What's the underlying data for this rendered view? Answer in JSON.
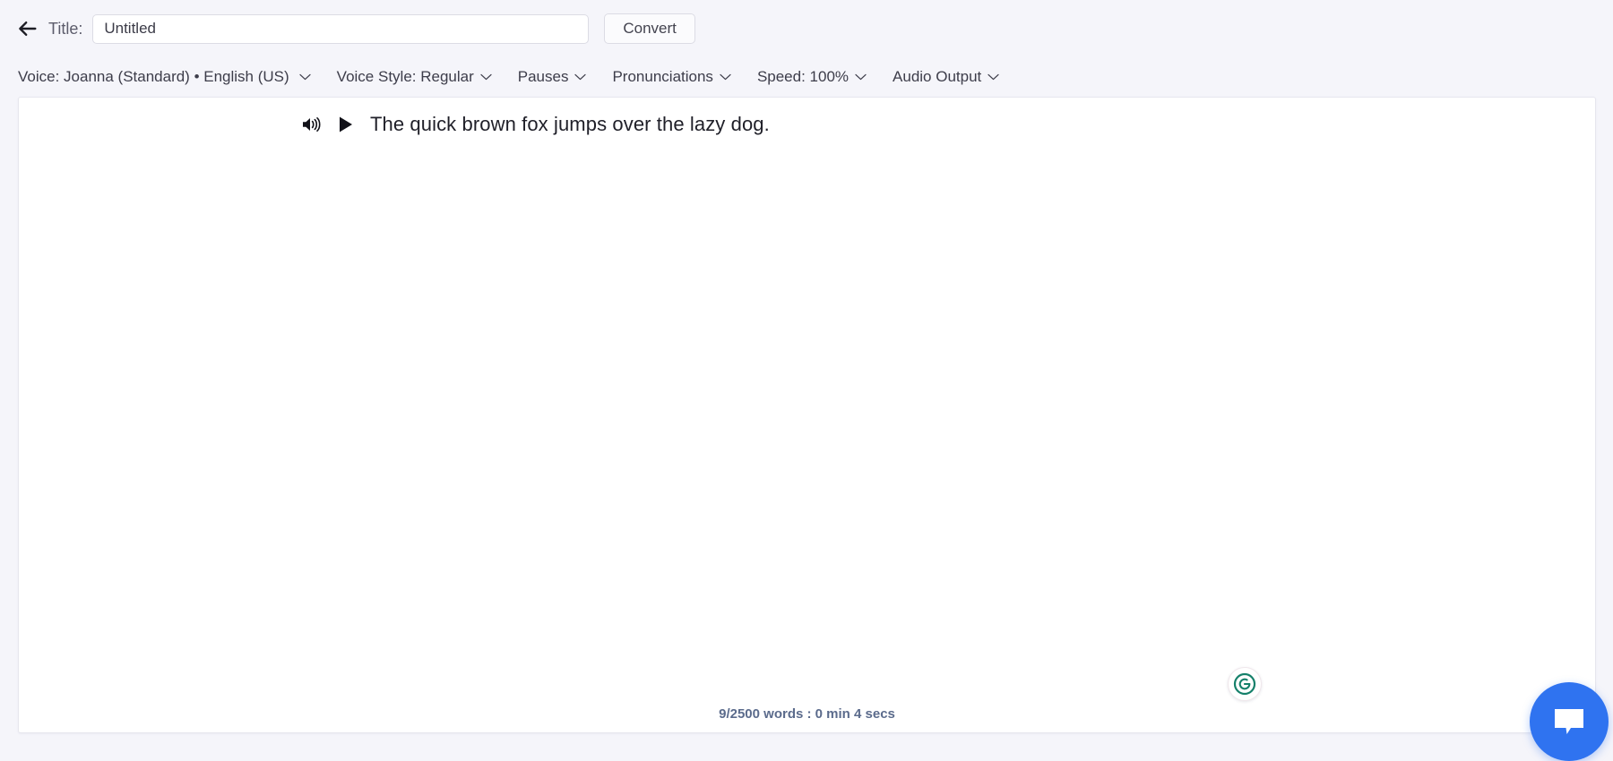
{
  "topbar": {
    "back_icon": "arrow-left-icon",
    "title_label": "Title:",
    "title_value": "Untitled",
    "title_placeholder": "Untitled",
    "convert_label": "Convert"
  },
  "options": [
    {
      "label": "Voice: Joanna (Standard) • English (US)",
      "name": "voice-selector",
      "icon": "chevron-down-icon"
    },
    {
      "label": "Voice Style: Regular",
      "name": "voice-style-selector",
      "icon": "chevron-down-icon"
    },
    {
      "label": "Pauses",
      "name": "pauses-selector",
      "icon": "chevron-down-icon"
    },
    {
      "label": "Pronunciations",
      "name": "pronunciations-selector",
      "icon": "chevron-down-icon"
    },
    {
      "label": "Speed: 100%",
      "name": "speed-selector",
      "icon": "chevron-down-icon"
    },
    {
      "label": "Audio Output",
      "name": "audio-output-selector",
      "icon": "chevron-down-icon"
    }
  ],
  "editor": {
    "sentence_text": "The quick brown fox jumps over the lazy dog.",
    "speaker_icon": "speaker-volume-icon",
    "play_icon": "play-triangle-icon",
    "word_count": "9/2500 words : 0 min 4 secs"
  },
  "overlays": {
    "grammarly_icon": "grammarly-logo-icon",
    "chat_icon": "chat-bubble-icon"
  },
  "colors": {
    "page_background": "#f5f5fa",
    "panel_background": "#ffffff",
    "panel_border": "#e6e6ee",
    "text_primary": "#1f1f28",
    "text_secondary": "#3d3d4a",
    "wordcount_text": "#5b6b8c",
    "grammarly_green": "#15806a",
    "chat_blue": "#2f73f0"
  }
}
